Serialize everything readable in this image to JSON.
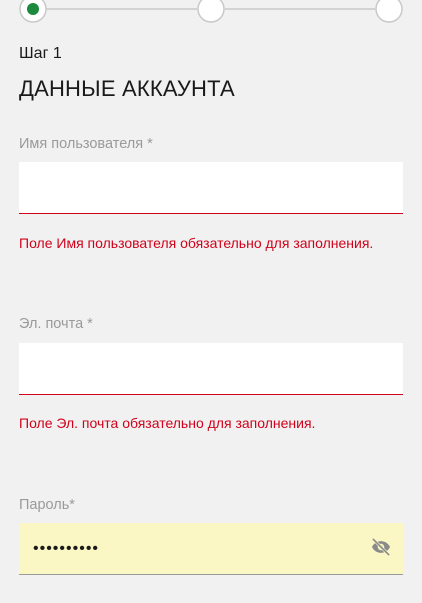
{
  "stepper": {
    "steps": [
      {
        "state": "active"
      },
      {
        "state": "inactive"
      },
      {
        "state": "inactive"
      }
    ],
    "active_color": "#1b8a3c",
    "line_color": "#c9c9c9"
  },
  "step_label": "Шаг 1",
  "section_title": "ДАННЫЕ АККАУНТА",
  "fields": {
    "username": {
      "label": "Имя пользователя *",
      "value": "",
      "error": "Поле Имя пользователя обязательно для заполнения."
    },
    "email": {
      "label": "Эл. почта *",
      "value": "",
      "error": "Поле Эл. почта обязательно для заполнения."
    },
    "password": {
      "label": "Пароль*",
      "value": "••••••••••",
      "toggle_icon": "eye-off-icon"
    }
  },
  "colors": {
    "error": "#d0021b",
    "autofill_bg": "#fbf7c4"
  }
}
